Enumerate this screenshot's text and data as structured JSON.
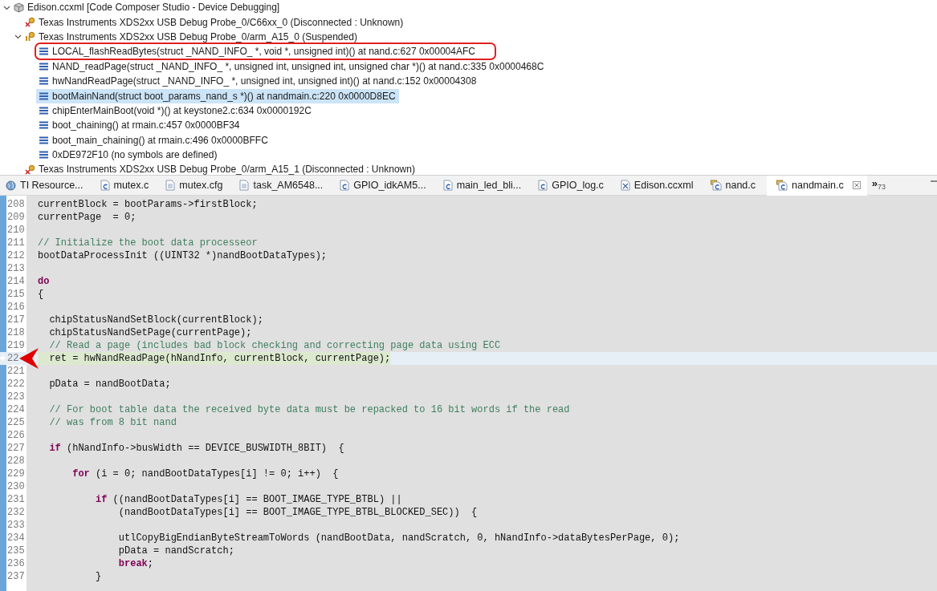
{
  "debug_tree": {
    "label": "Edison.ccxml [Code Composer Studio - Device Debugging]",
    "expanded": true,
    "children": [
      {
        "kind": "disconnected-core",
        "label": "Texas Instruments XDS2xx USB Debug Probe_0/C66xx_0 (Disconnected : Unknown)",
        "expanded": false
      },
      {
        "kind": "suspended-core",
        "label": "Texas Instruments XDS2xx USB Debug Probe_0/arm_A15_0 (Suspended)",
        "expanded": true,
        "children": [
          {
            "kind": "frame",
            "label": "LOCAL_flashReadBytes(struct _NAND_INFO_ *, void *, unsigned int)() at nand.c:627 0x00004AFC",
            "selected": false,
            "circled": true
          },
          {
            "kind": "frame",
            "label": "NAND_readPage(struct _NAND_INFO_ *, unsigned int, unsigned int, unsigned char *)() at nand.c:335 0x0000468C",
            "selected": false,
            "circled": false
          },
          {
            "kind": "frame",
            "label": "hwNandReadPage(struct _NAND_INFO_ *, unsigned int, unsigned int)() at nand.c:152 0x00004308",
            "selected": false,
            "circled": false
          },
          {
            "kind": "frame",
            "label": "bootMainNand(struct boot_params_nand_s *)() at nandmain.c:220 0x0000D8EC",
            "selected": true,
            "circled": false
          },
          {
            "kind": "frame",
            "label": "chipEnterMainBoot(void *)() at keystone2.c:634 0x0000192C",
            "selected": false,
            "circled": false
          },
          {
            "kind": "frame",
            "label": "boot_chaining() at rmain.c:457 0x0000BF34",
            "selected": false,
            "circled": false
          },
          {
            "kind": "frame",
            "label": "boot_main_chaining() at rmain.c:496 0x0000BFFC",
            "selected": false,
            "circled": false
          },
          {
            "kind": "frame",
            "label": "0xDE972F10  (no symbols are defined)",
            "selected": false,
            "circled": false
          }
        ]
      },
      {
        "kind": "disconnected-core",
        "label": "Texas Instruments XDS2xx USB Debug Probe_0/arm_A15_1 (Disconnected : Unknown)",
        "expanded": false
      }
    ]
  },
  "editor_tabs": [
    {
      "label": "TI Resource...",
      "kind": "web",
      "selected": false
    },
    {
      "label": "mutex.c",
      "kind": "c",
      "selected": false
    },
    {
      "label": "mutex.cfg",
      "kind": "text",
      "selected": false
    },
    {
      "label": "task_AM6548...",
      "kind": "text",
      "selected": false
    },
    {
      "label": "GPIO_idkAM5...",
      "kind": "c",
      "selected": false
    },
    {
      "label": "main_led_bli...",
      "kind": "c",
      "selected": false
    },
    {
      "label": "GPIO_log.c",
      "kind": "c",
      "selected": false
    },
    {
      "label": "Edison.ccxml",
      "kind": "config",
      "selected": false
    },
    {
      "label": "nand.c",
      "kind": "project-c",
      "selected": false
    },
    {
      "label": "nandmain.c",
      "kind": "project-c",
      "selected": true
    }
  ],
  "tab_overflow": {
    "glyph": "»",
    "count": "73"
  },
  "code_lines": [
    {
      "number": "208",
      "current": false,
      "tokens": [
        {
          "kind": "code",
          "text": "currentBlock = bootParams->firstBlock;"
        }
      ]
    },
    {
      "number": "209",
      "current": false,
      "tokens": [
        {
          "kind": "code",
          "text": "currentPage  = 0;"
        }
      ]
    },
    {
      "number": "210",
      "current": false
    },
    {
      "number": "211",
      "current": false,
      "tokens": [
        {
          "kind": "comment",
          "text": "// Initialize the boot data processeor"
        }
      ]
    },
    {
      "number": "212",
      "current": false,
      "tokens": [
        {
          "kind": "code",
          "text": "bootDataProcessInit ((UINT32 *)nandBootDataTypes);"
        }
      ]
    },
    {
      "number": "213",
      "current": false
    },
    {
      "number": "214",
      "current": false,
      "tokens": [
        {
          "kind": "keyword",
          "text": "do"
        }
      ]
    },
    {
      "number": "215",
      "current": false,
      "tokens": [
        {
          "kind": "code",
          "text": "{"
        }
      ]
    },
    {
      "number": "216",
      "current": false
    },
    {
      "number": "217",
      "current": false,
      "tokens": [
        {
          "kind": "code",
          "text": "  chipStatusNandSetBlock(currentBlock);"
        }
      ]
    },
    {
      "number": "218",
      "current": false,
      "tokens": [
        {
          "kind": "code",
          "text": "  chipStatusNandSetPage(currentPage);"
        }
      ]
    },
    {
      "number": "219",
      "current": false,
      "tokens": [
        {
          "kind": "comment",
          "text": "  // Read a page (includes bad block checking and correcting page data using ECC"
        }
      ]
    },
    {
      "number": "22",
      "current": true,
      "tokens": [
        {
          "kind": "code",
          "text": "  ret = hwNandReadPage(hNandInfo, currentBlock, currentPage);"
        }
      ]
    },
    {
      "number": "221",
      "current": false
    },
    {
      "number": "222",
      "current": false,
      "tokens": [
        {
          "kind": "code",
          "text": "  pData = nandBootData;"
        }
      ]
    },
    {
      "number": "223",
      "current": false
    },
    {
      "number": "224",
      "current": false,
      "tokens": [
        {
          "kind": "comment",
          "text": "  // For boot table data the received byte data must be repacked to 16 bit words if the read"
        }
      ]
    },
    {
      "number": "225",
      "current": false,
      "tokens": [
        {
          "kind": "comment",
          "text": "  // was from 8 bit nand"
        }
      ]
    },
    {
      "number": "226",
      "current": false
    },
    {
      "number": "227",
      "current": false,
      "tokens": [
        {
          "kind": "keyword",
          "text": "  if"
        },
        {
          "kind": "code",
          "text": " (hNandInfo->busWidth == DEVICE_BUSWIDTH_8BIT)  {"
        }
      ]
    },
    {
      "number": "228",
      "current": false
    },
    {
      "number": "229",
      "current": false,
      "tokens": [
        {
          "kind": "keyword",
          "text": "      for"
        },
        {
          "kind": "code",
          "text": " (i = 0; nandBootDataTypes[i] != 0; i++)  {"
        }
      ]
    },
    {
      "number": "230",
      "current": false
    },
    {
      "number": "231",
      "current": false,
      "tokens": [
        {
          "kind": "keyword",
          "text": "          if"
        },
        {
          "kind": "code",
          "text": " ((nandBootDataTypes[i] == BOOT_IMAGE_TYPE_BTBL) ||"
        }
      ]
    },
    {
      "number": "232",
      "current": false,
      "tokens": [
        {
          "kind": "code",
          "text": "              (nandBootDataTypes[i] == BOOT_IMAGE_TYPE_BTBL_BLOCKED_SEC))  {"
        }
      ]
    },
    {
      "number": "233",
      "current": false
    },
    {
      "number": "234",
      "current": false,
      "tokens": [
        {
          "kind": "code",
          "text": "              utlCopyBigEndianByteStreamToWords (nandBootData, nandScratch, 0, hNandInfo->dataBytesPerPage, 0);"
        }
      ]
    },
    {
      "number": "235",
      "current": false,
      "tokens": [
        {
          "kind": "code",
          "text": "              pData = nandScratch;"
        }
      ]
    },
    {
      "number": "236",
      "current": false,
      "tokens": [
        {
          "kind": "keyword",
          "text": "              break"
        },
        {
          "kind": "code",
          "text": ";"
        }
      ]
    },
    {
      "number": "237",
      "current": false,
      "tokens": [
        {
          "kind": "code",
          "text": "          }"
        }
      ]
    }
  ]
}
